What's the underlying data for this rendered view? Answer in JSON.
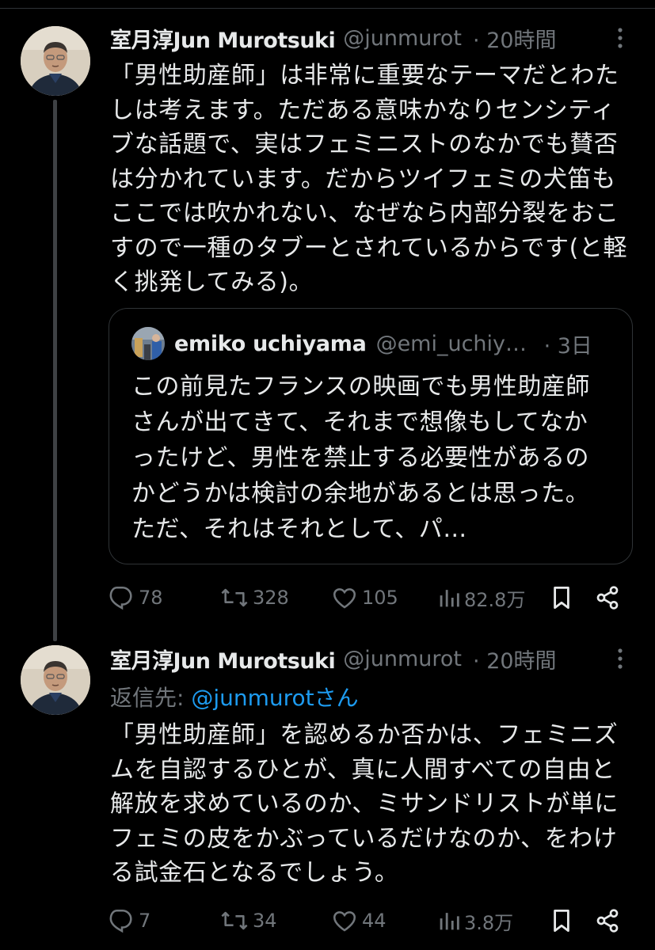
{
  "tweets": [
    {
      "name": "室月淳Jun Murotsuki",
      "handle": "@junmurot",
      "time": "· 20時間",
      "text": "「男性助産師」は非常に重要なテーマだとわたしは考えます。ただある意味かなりセンシティブな話題で、実はフェミニストのなかでも賛否は分かれています。だからツイフェミの犬笛もここでは吹かれない、なぜなら内部分裂をおこすので一種のタブーとされているからです(と軽く挑発してみる)。",
      "quote": {
        "name": "emiko uchiyama",
        "handle": "@emi_uchiyama",
        "time": "· 3日",
        "text": "この前見たフランスの映画でも男性助産師さんが出てきて、それまで想像もしてなかったけど、男性を禁止する必要性があるのかどうかは検討の余地があるとは思った。ただ、それはそれとして、パ…"
      },
      "actions": {
        "replies": "78",
        "retweets": "328",
        "likes": "105",
        "views": "82.8万"
      }
    },
    {
      "name": "室月淳Jun Murotsuki",
      "handle": "@junmurot",
      "time": "· 20時間",
      "reply_prefix": "返信先: ",
      "reply_mention": "@junmurotさん",
      "text": "「男性助産師」を認めるか否かは、フェミニズムを自認するひとが、真に人間すべての自由と解放を求めているのか、ミサンドリストが単にフェミの皮をかぶっているだけなのか、をわける試金石となるでしょう。",
      "actions": {
        "replies": "7",
        "retweets": "34",
        "likes": "44",
        "views": "3.8万"
      }
    }
  ],
  "icons": [
    "more-icon",
    "reply-icon",
    "retweet-icon",
    "like-icon",
    "views-icon",
    "bookmark-icon",
    "share-icon"
  ],
  "colors": {
    "background": "#000000",
    "text": "#e7e9ea",
    "muted": "#71767b",
    "link": "#1d9bf0",
    "border": "#2f3336"
  }
}
